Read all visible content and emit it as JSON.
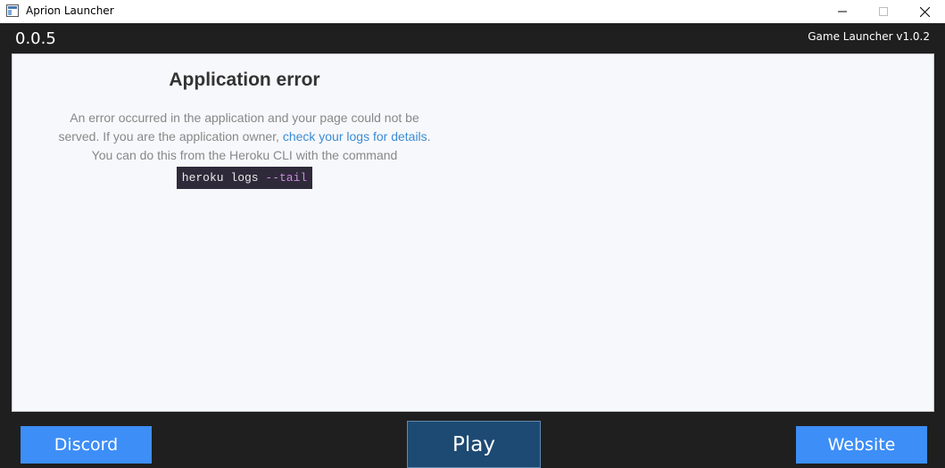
{
  "window": {
    "title": "Aprion Launcher",
    "icon": "app-icon"
  },
  "header": {
    "version": "0.0.5",
    "launcher_version": "Game Launcher v1.0.2"
  },
  "error_page": {
    "title": "Application error",
    "line1": "An error occurred in the application and your page could not be",
    "line2_prefix": "served. If you are the application owner, ",
    "line2_link": "check your logs for details",
    "line2_suffix": ".",
    "line3": "You can do this from the Heroku CLI with the command",
    "command_main": "heroku logs ",
    "command_flag": "--tail"
  },
  "buttons": {
    "discord": "Discord",
    "play": "Play",
    "website": "Website"
  },
  "colors": {
    "accent_blue": "#3d8ef7",
    "play_bg": "#1d4a73",
    "background": "#1f1f1f"
  }
}
